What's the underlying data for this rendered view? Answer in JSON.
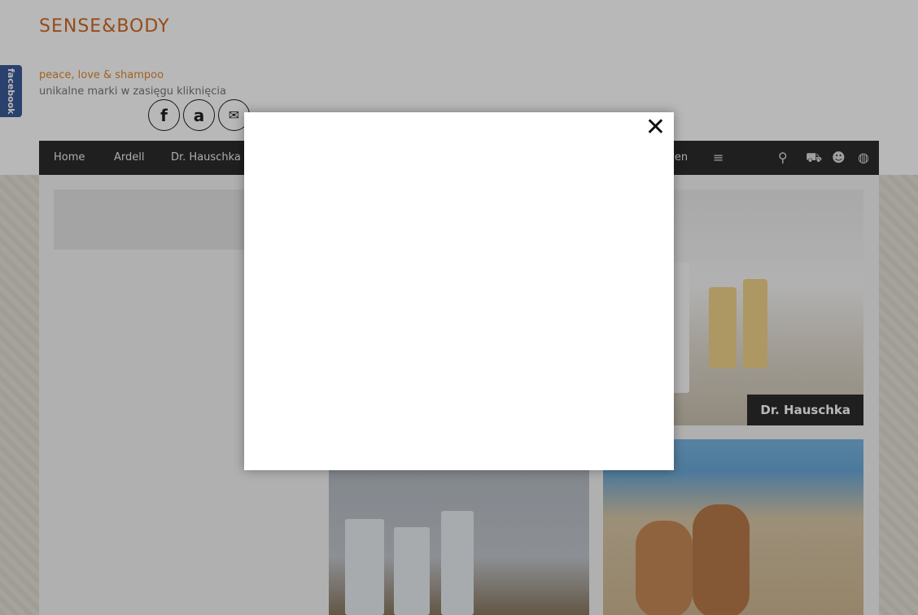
{
  "brand": {
    "logo_text": "SENSE&BODY",
    "tagline": "peace, love & shampoo",
    "subtagline": "unikalne marki w zasięgu kliknięcia"
  },
  "facebook_tab": {
    "label": "facebook"
  },
  "social": [
    {
      "icon": "facebook-icon",
      "glyph": "f"
    },
    {
      "icon": "allegro-icon",
      "glyph": "a"
    },
    {
      "icon": "mail-icon",
      "glyph": "✉"
    }
  ],
  "nav": {
    "items": [
      "Home",
      "Ardell",
      "Dr. Hauschka"
    ],
    "partial_item": "zen",
    "icons": [
      "menu-icon",
      "search-icon",
      "cart-icon",
      "user-icon",
      "globe-icon"
    ]
  },
  "tiles": {
    "dr_label": "Dr. Hauschka"
  },
  "modal": {
    "close_glyph": "✕"
  },
  "colors": {
    "accent": "#e08830",
    "nav_bg": "#2c2c2c",
    "facebook": "#3b5998"
  }
}
